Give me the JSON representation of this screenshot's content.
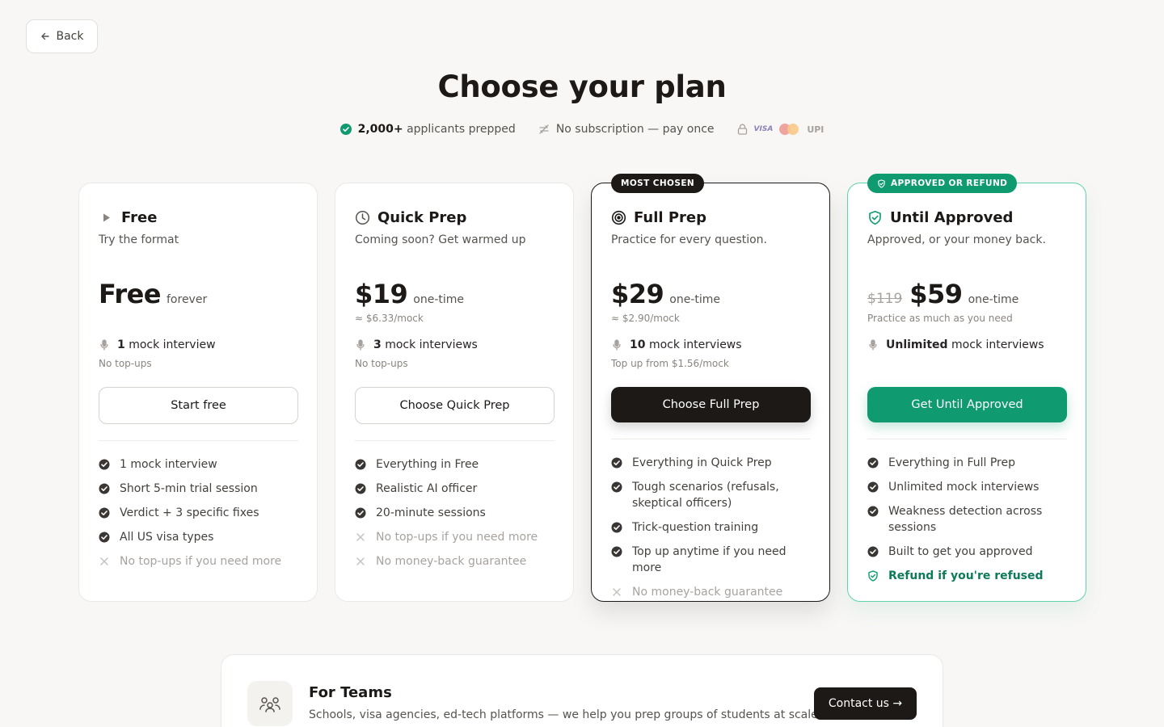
{
  "nav": {
    "back_label": "Back"
  },
  "header": {
    "title": "Choose your plan"
  },
  "trust": {
    "applicants_count": "2,000+",
    "applicants_text": "applicants prepped",
    "subscription_text": "No subscription — pay once",
    "payment_methods": [
      "VISA",
      "Mastercard",
      "UPI"
    ],
    "visa_label": "VISA",
    "upi_label": "UPI"
  },
  "plans": [
    {
      "name": "Free",
      "icon": "play-icon",
      "subtitle": "Try the format",
      "old_price": "",
      "price": "Free",
      "price_suffix": "forever",
      "per_mock": "",
      "mocks_count": "1",
      "mocks_label": "mock interview",
      "topup": "No top-ups",
      "cta": "Start free",
      "features": [
        {
          "text": "1 mock interview",
          "included": true
        },
        {
          "text": "Short 5-min trial session",
          "included": true
        },
        {
          "text": "Verdict + 3 specific fixes",
          "included": true
        },
        {
          "text": "All US visa types",
          "included": true
        },
        {
          "text": "No top-ups if you need more",
          "included": false
        }
      ]
    },
    {
      "name": "Quick Prep",
      "icon": "clock-icon",
      "subtitle": "Coming soon? Get warmed up",
      "old_price": "",
      "price": "$19",
      "price_suffix": "one-time",
      "per_mock": "≈ $6.33/mock",
      "mocks_count": "3",
      "mocks_label": "mock interviews",
      "topup": "No top-ups",
      "cta": "Choose Quick Prep",
      "features": [
        {
          "text": "Everything in Free",
          "included": true
        },
        {
          "text": "Realistic AI officer",
          "included": true
        },
        {
          "text": "20-minute sessions",
          "included": true
        },
        {
          "text": "No top-ups if you need more",
          "included": false
        },
        {
          "text": "No money-back guarantee",
          "included": false
        }
      ]
    },
    {
      "name": "Full Prep",
      "icon": "target-icon",
      "badge": "MOST CHOSEN",
      "subtitle": "Practice for every question.",
      "old_price": "",
      "price": "$29",
      "price_suffix": "one-time",
      "per_mock": "≈ $2.90/mock",
      "mocks_count": "10",
      "mocks_label": "mock interviews",
      "topup": "Top up from $1.56/mock",
      "cta": "Choose Full Prep",
      "features": [
        {
          "text": "Everything in Quick Prep",
          "included": true
        },
        {
          "text": "Tough scenarios (refusals, skeptical officers)",
          "included": true
        },
        {
          "text": "Trick-question training",
          "included": true
        },
        {
          "text": "Top up anytime if you need more",
          "included": true
        },
        {
          "text": "No money-back guarantee",
          "included": false
        }
      ]
    },
    {
      "name": "Until Approved",
      "icon": "shield-check-icon",
      "badge": "APPROVED OR REFUND",
      "subtitle": "Approved, or your money back.",
      "old_price": "$119",
      "price": "$59",
      "price_suffix": "one-time",
      "per_mock": "Practice as much as you need",
      "mocks_count": "Unlimited",
      "mocks_label": "mock interviews",
      "topup": "",
      "cta": "Get Until Approved",
      "features": [
        {
          "text": "Everything in Full Prep",
          "included": true
        },
        {
          "text": "Unlimited mock interviews",
          "included": true
        },
        {
          "text": "Weakness detection across sessions",
          "included": true
        },
        {
          "text": "Built to get you approved",
          "included": true
        },
        {
          "text": "Refund if you're refused",
          "included": true,
          "highlight": true
        }
      ]
    }
  ],
  "teams": {
    "title": "For Teams",
    "description": "Schools, visa agencies, ed-tech platforms — we help you prep groups of students at scale.",
    "cta": "Contact us →"
  },
  "colors": {
    "background": "#f8f7f5",
    "dark": "#1c1917",
    "accent_green": "#0f9a6f",
    "muted": "#a8a29e"
  }
}
